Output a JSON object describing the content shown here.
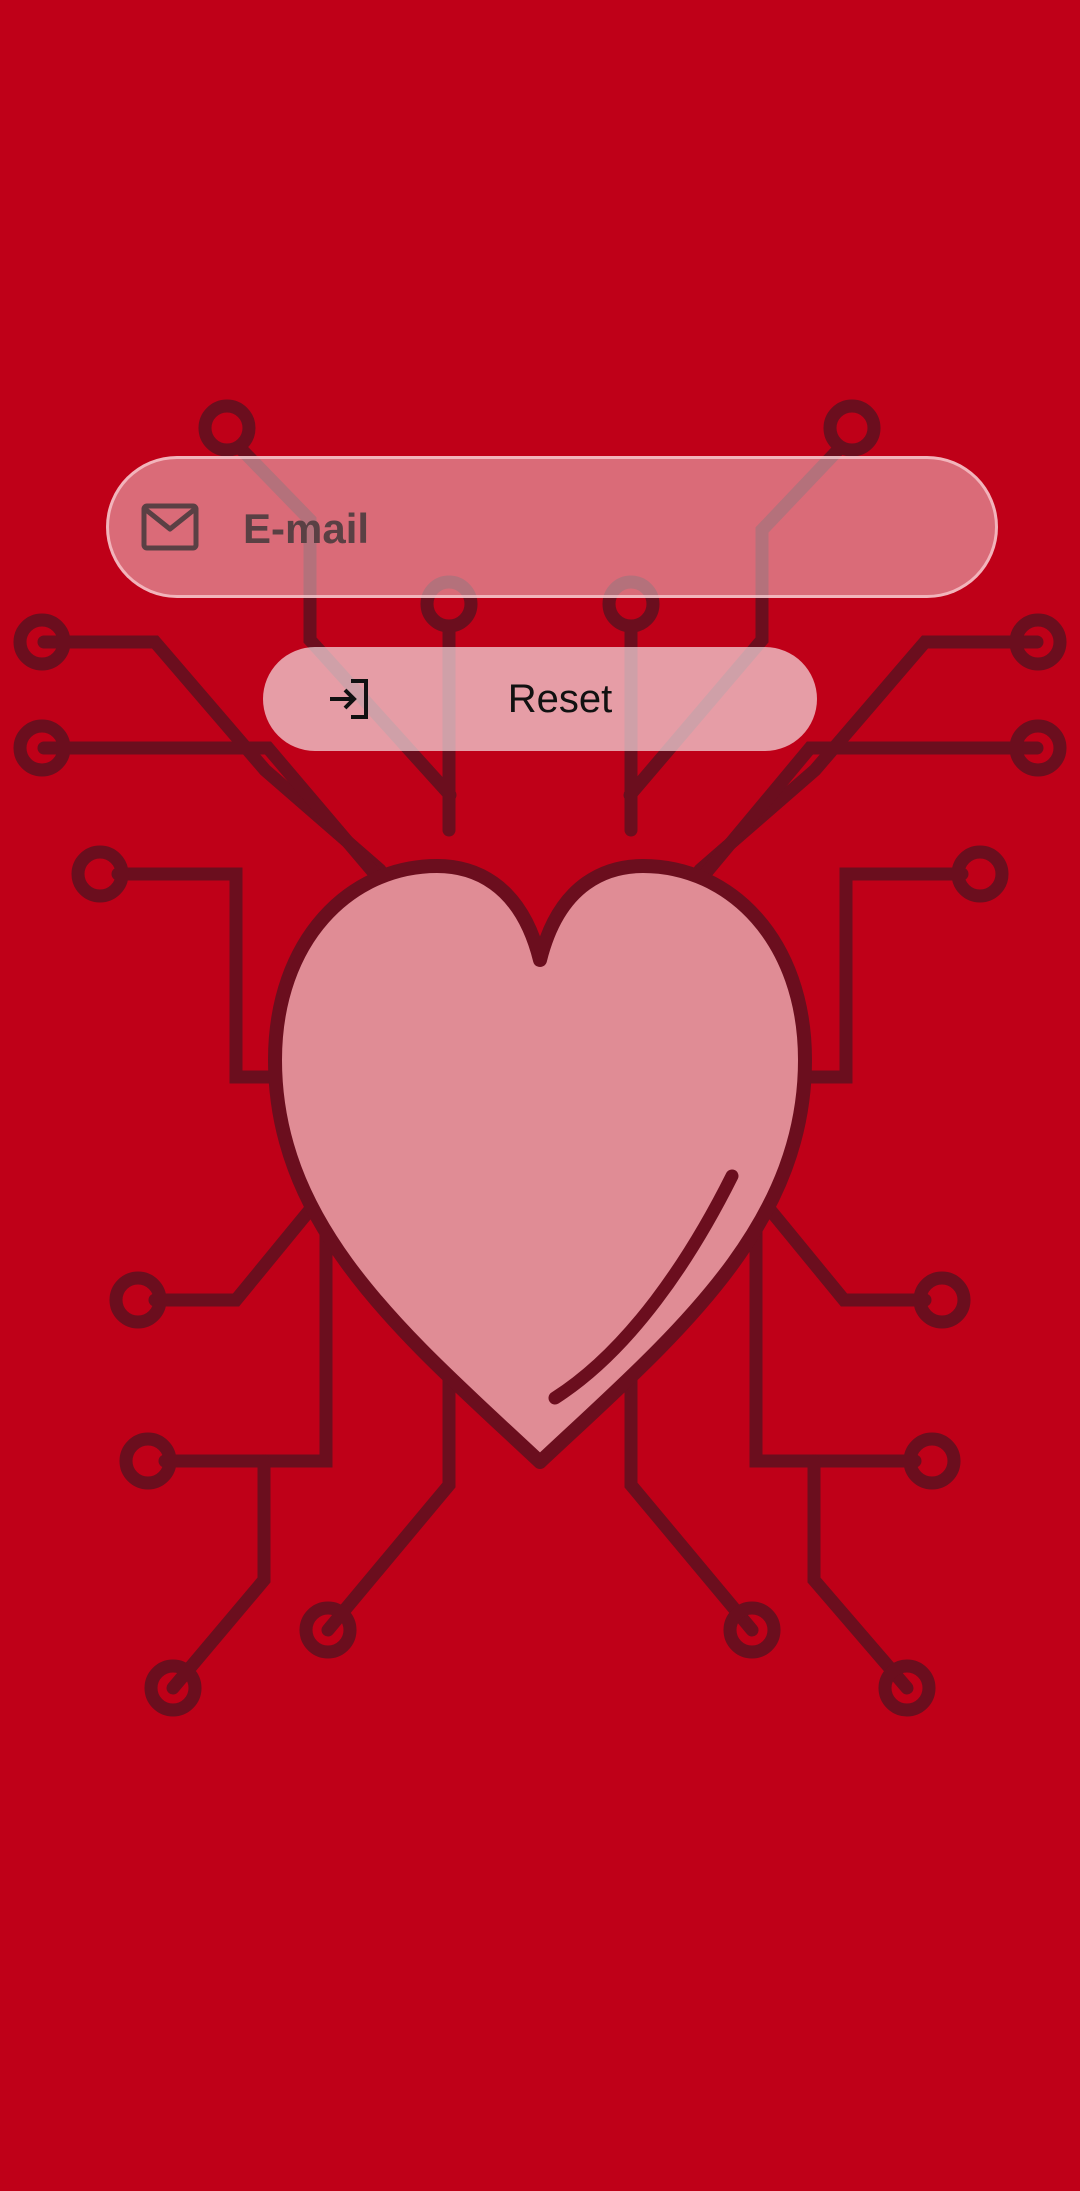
{
  "email": {
    "placeholder": "E-mail",
    "value": "",
    "icon": "mail-icon"
  },
  "reset": {
    "label": "Reset",
    "icon": "login-icon"
  },
  "colors": {
    "background": "#bf0018",
    "circuit": "#6b0e1e",
    "heart_fill": "#e08c95",
    "field_bg": "#f0c3c8",
    "button_bg": "#f5dade"
  },
  "background_art": "circuit-heart"
}
